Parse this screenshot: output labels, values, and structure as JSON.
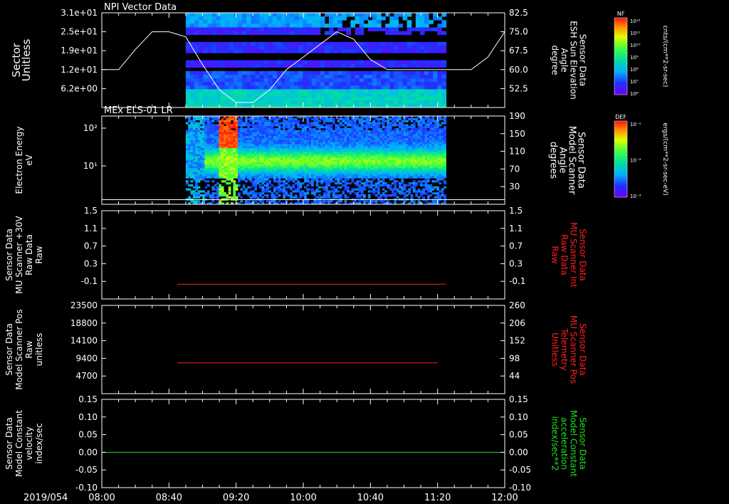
{
  "date_label": "2019/054",
  "x_ticks": [
    "08:00",
    "08:40",
    "09:20",
    "10:00",
    "10:40",
    "11:20",
    "12:00"
  ],
  "colors": {
    "red": "#ff2020",
    "green": "#20e020",
    "white": "#ffffff"
  },
  "panels": [
    {
      "title": "NPI Vector Data",
      "ylabel_left": [
        "Sector",
        "Unitless"
      ],
      "ylabel_right": [
        "Sensor Data",
        "ESH Sun Elevation",
        "Angle",
        "degree"
      ],
      "yticks_left": [
        "3.1e+01",
        "2.5e+01",
        "1.9e+01",
        "1.2e+01",
        "6.2e+00"
      ],
      "yticks_right": [
        "82.5",
        "75.0",
        "67.5",
        "60.0",
        "52.5"
      ],
      "colorbar": {
        "label": "NF",
        "units": "cnts/(cm**2-sr-sec)",
        "ticks": [
          "10¹²",
          "10¹¹",
          "10¹⁰",
          "10⁹",
          "10⁸",
          "10⁷",
          "10⁶"
        ]
      }
    },
    {
      "title": "MEx ELS-01 LR",
      "ylabel_left": [
        "Electron Energy",
        "eV"
      ],
      "ylabel_right": [
        "Sensor Data",
        "Model Scanner",
        "Angle",
        "degrees"
      ],
      "yticks_left": [
        "10²",
        "10¹"
      ],
      "yticks_right": [
        "190",
        "150",
        "110",
        "70",
        "30"
      ],
      "colorbar": {
        "label": "DEF",
        "units": "ergs/(cm**2-sr-sec-eV)",
        "ticks": [
          "10⁻¹",
          "10⁻²",
          "10⁻³"
        ]
      }
    },
    {
      "title": "",
      "ylabel_left": [
        "Sensor Data",
        "MU Scanner +30V",
        "Raw Data",
        "Raw"
      ],
      "ylabel_right": [
        "Sensor Data",
        "MU Scanner Int",
        "Raw Data",
        "Raw"
      ],
      "yticks_left": [
        "1.5",
        "1.1",
        "0.7",
        "0.3",
        "-0.1"
      ],
      "yticks_right": [
        "1.5",
        "1.1",
        "0.7",
        "0.3",
        "-0.1"
      ]
    },
    {
      "title": "",
      "ylabel_left": [
        "Sensor Data",
        "Model Scanner Pos",
        "Raw",
        "unitless"
      ],
      "ylabel_right": [
        "Sensor Data",
        "MU Scanner Pos",
        "Telemetry",
        "Unitless"
      ],
      "yticks_left": [
        "23500",
        "18800",
        "14100",
        "9400",
        "4700"
      ],
      "yticks_right": [
        "260",
        "206",
        "152",
        "98",
        "44"
      ]
    },
    {
      "title": "",
      "ylabel_left": [
        "Sensor Data",
        "Model Constant",
        "velocity",
        "index/sec"
      ],
      "ylabel_right": [
        "Sensor Data",
        "Model Constant",
        "acceleration",
        "index/sec**2"
      ],
      "yticks_left": [
        "0.15",
        "0.10",
        "0.05",
        "0.00",
        "-0.05",
        "-0.10"
      ],
      "yticks_right": [
        "0.15",
        "0.10",
        "0.05",
        "0.00",
        "-0.05",
        "-0.10"
      ]
    }
  ],
  "chart_data": [
    {
      "type": "heatmap",
      "title": "NPI Vector Data",
      "x_range": [
        "08:00",
        "12:00"
      ],
      "data_span": [
        "08:50",
        "11:25"
      ],
      "ylim": [
        0,
        31
      ],
      "line_overlay": {
        "name": "ESH Sun Elevation",
        "color": "#ffffff",
        "x": [
          "08:00",
          "08:10",
          "08:20",
          "08:30",
          "08:40",
          "08:50",
          "09:00",
          "09:10",
          "09:20",
          "09:30",
          "09:40",
          "09:50",
          "10:00",
          "10:10",
          "10:20",
          "10:30",
          "10:40",
          "10:50",
          "11:00",
          "11:10",
          "11:20",
          "11:30",
          "11:40",
          "11:50",
          "12:00"
        ],
        "y": [
          60,
          60,
          68,
          75,
          75,
          73,
          62,
          52,
          47,
          47,
          52,
          60,
          65,
          70,
          75,
          72,
          64,
          60,
          60,
          60,
          60,
          60,
          60,
          65,
          75
        ],
        "ylim": [
          45,
          82.5
        ]
      }
    },
    {
      "type": "heatmap",
      "title": "MEx ELS-01 LR",
      "x_range": [
        "08:00",
        "12:00"
      ],
      "data_span": [
        "08:50",
        "11:25"
      ],
      "yscale": "log",
      "ylim": [
        1,
        200
      ],
      "ylabel": "Electron Energy eV",
      "hot_spot": {
        "time": "09:15",
        "energy_range": [
          40,
          200
        ]
      },
      "line_overlay": {
        "name": "Model Scanner Angle",
        "y": 10,
        "ylim": [
          0,
          190
        ]
      }
    },
    {
      "type": "line",
      "x_range": [
        "08:00",
        "12:00"
      ],
      "ylim": [
        -0.3,
        1.5
      ],
      "series": [
        {
          "name": "MU Scanner Int Raw Data",
          "color": "#ff2020",
          "x": [
            "08:45",
            "11:25"
          ],
          "y": [
            0.0,
            0.0
          ]
        }
      ]
    },
    {
      "type": "line",
      "x_range": [
        "08:00",
        "12:00"
      ],
      "ylim": [
        0,
        23500
      ],
      "series": [
        {
          "name": "MU Scanner Pos Telemetry",
          "color": "#ff2020",
          "x": [
            "08:45",
            "11:20"
          ],
          "y": [
            8200,
            8200
          ]
        }
      ]
    },
    {
      "type": "line",
      "x_range": [
        "08:00",
        "12:00"
      ],
      "ylim": [
        -0.1,
        0.15
      ],
      "series": [
        {
          "name": "Model Constant acceleration",
          "color": "#20e020",
          "x": [
            "08:00",
            "12:00"
          ],
          "y": [
            0.0,
            0.0
          ]
        }
      ]
    }
  ]
}
